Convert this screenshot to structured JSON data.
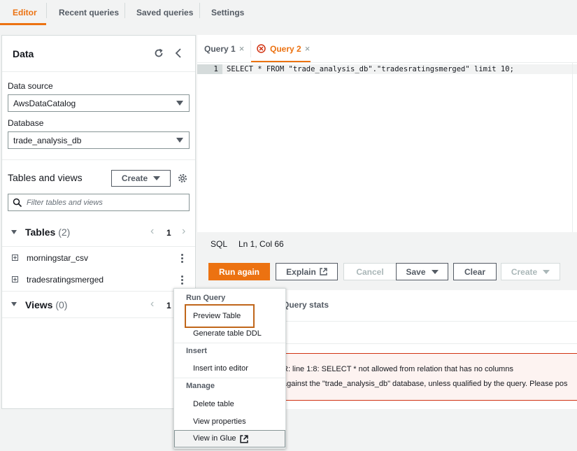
{
  "topnav": {
    "tabs": [
      {
        "label": "Editor",
        "active": true
      },
      {
        "label": "Recent queries",
        "active": false
      },
      {
        "label": "Saved queries",
        "active": false
      },
      {
        "label": "Settings",
        "active": false
      }
    ]
  },
  "data_panel": {
    "title": "Data",
    "refresh_icon": "refresh-icon",
    "collapse_icon": "chevron-left-icon",
    "data_source": {
      "label": "Data source",
      "value": "AwsDataCatalog"
    },
    "database": {
      "label": "Database",
      "value": "trade_analysis_db"
    },
    "tables_and_views": {
      "title": "Tables and views",
      "create_label": "Create",
      "settings_icon": "gear-icon",
      "filter_placeholder": "Filter tables and views"
    },
    "tables": {
      "label": "Tables",
      "count": "(2)",
      "page": "1",
      "items": [
        {
          "name": "morningstar_csv"
        },
        {
          "name": "tradesratingsmerged"
        }
      ]
    },
    "views": {
      "label": "Views",
      "count": "(0)",
      "page": "1"
    }
  },
  "editor": {
    "tabs": [
      {
        "label": "Query 1",
        "active": false,
        "error": false
      },
      {
        "label": "Query 2",
        "active": true,
        "error": true
      }
    ],
    "line_number": "1",
    "code": "SELECT * FROM \"trade_analysis_db\".\"tradesratingsmerged\" limit 10;",
    "status": {
      "language": "SQL",
      "position": "Ln 1, Col 66"
    }
  },
  "actions": {
    "run_again": "Run again",
    "explain": "Explain",
    "cancel": "Cancel",
    "save": "Save",
    "clear": "Clear",
    "create": "Create"
  },
  "results": {
    "tab_query_stats": "Query stats",
    "error_line1": "R: line 1:8: SELECT * not allowed from relation that has no columns",
    "error_line2": "against the \"trade_analysis_db\" database, unless qualified by the query. Please pos"
  },
  "context_menu": {
    "run_query": {
      "heading": "Run Query",
      "items": [
        "Preview Table",
        "Generate table DDL"
      ]
    },
    "insert": {
      "heading": "Insert",
      "items": [
        "Insert into editor"
      ]
    },
    "manage": {
      "heading": "Manage",
      "items": [
        "Delete table",
        "View properties",
        "View in Glue"
      ]
    }
  },
  "colors": {
    "accent": "#ec7211",
    "error": "#d13212",
    "highlight_border": "#c0661a"
  }
}
